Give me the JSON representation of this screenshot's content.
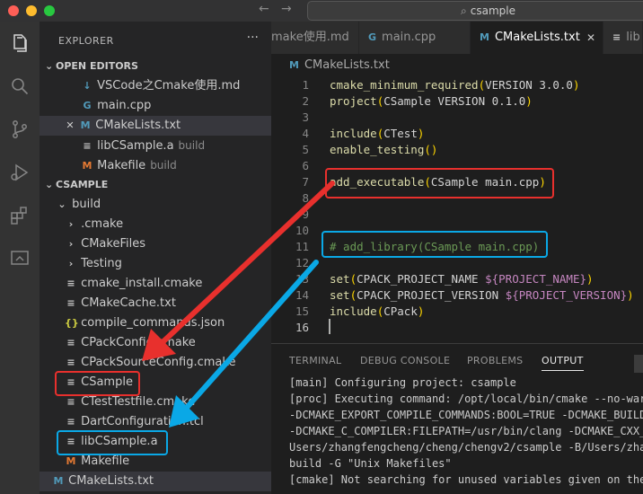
{
  "titlebar": {
    "search_text": "csample",
    "search_icon": "search-icon"
  },
  "activity": {
    "icons": [
      "files-icon",
      "search-icon",
      "source-control-icon",
      "run-debug-icon",
      "extensions-icon",
      "remote-explorer-icon"
    ]
  },
  "sidebar": {
    "title": "EXPLORER",
    "more": "···",
    "open_editors": {
      "header": "OPEN EDITORS",
      "items": [
        {
          "icon": "markdown-icon",
          "label": "VSCode之Cmake使用.md",
          "desc": ""
        },
        {
          "icon": "cpp-icon",
          "label": "main.cpp",
          "desc": ""
        },
        {
          "icon": "cmake-icon",
          "label": "CMakeLists.txt",
          "desc": ""
        },
        {
          "icon": "file-icon",
          "label": "libCSample.a",
          "desc": "build"
        },
        {
          "icon": "makefile-icon",
          "label": "Makefile",
          "desc": "build"
        }
      ]
    },
    "workspace": {
      "header": "CSAMPLE",
      "items": [
        {
          "label": "build"
        },
        {
          "label": ".cmake"
        },
        {
          "label": "CMakeFiles"
        },
        {
          "label": "Testing"
        },
        {
          "label": "cmake_install.cmake"
        },
        {
          "label": "CMakeCache.txt"
        },
        {
          "label": "compile_commands.json"
        },
        {
          "label": "CPackConfig.cmake"
        },
        {
          "label": "CPackSourceConfig.cmake"
        },
        {
          "label": "CSample"
        },
        {
          "label": "CTestTestfile.cmake"
        },
        {
          "label": "DartConfiguration.tcl"
        },
        {
          "label": "libCSample.a"
        },
        {
          "label": "Makefile"
        },
        {
          "label": "CMakeLists.txt"
        }
      ]
    }
  },
  "tabs": [
    {
      "label": "make使用.md",
      "icon": ""
    },
    {
      "label": "main.cpp",
      "icon": "cpp-icon"
    },
    {
      "label": "CMakeLists.txt",
      "icon": "cmake-icon"
    },
    {
      "label": "lib",
      "icon": "file-icon"
    }
  ],
  "tab_close": "✕",
  "breadcrumb": "CMakeLists.txt",
  "code": {
    "line_numbers": [
      "1",
      "2",
      "3",
      "4",
      "5",
      "6",
      "7",
      "8",
      "9",
      "10",
      "11",
      "12",
      "13",
      "14",
      "15",
      "16"
    ]
  },
  "panel": {
    "tabs": [
      "TERMINAL",
      "DEBUG CONSOLE",
      "PROBLEMS",
      "OUTPUT"
    ],
    "output": [
      "[main] Configuring project: csample",
      "[proc] Executing command: /opt/local/bin/cmake --no-war",
      "-DCMAKE_EXPORT_COMPILE_COMMANDS:BOOL=TRUE -DCMAKE_BUILD",
      "-DCMAKE_C_COMPILER:FILEPATH=/usr/bin/clang -DCMAKE_CXX_",
      "Users/zhangfengcheng/cheng/chengv2/csample -B/Users/zha",
      "build -G \"Unix Makefiles\"",
      "[cmake] Not searching for unused variables given on the"
    ]
  },
  "colors": {
    "highlight_red": "#e8302d",
    "highlight_blue": "#0aa8e6"
  }
}
